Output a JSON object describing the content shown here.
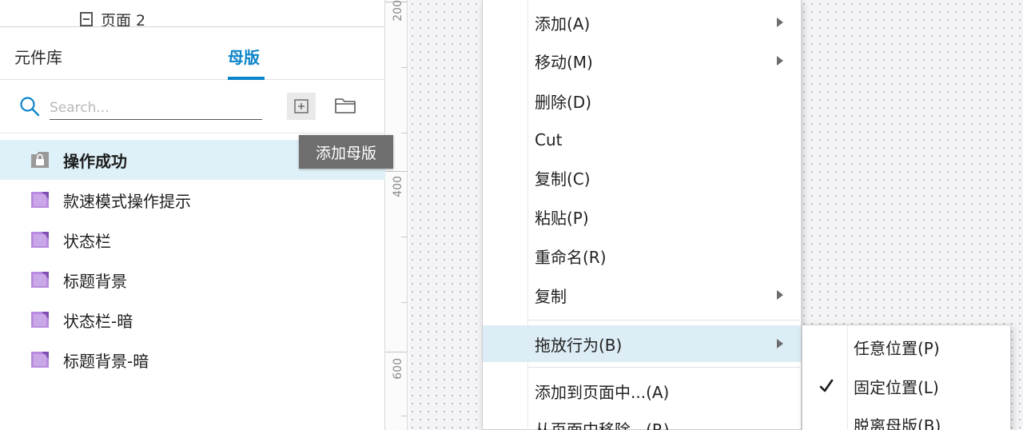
{
  "pages": {
    "partial_page_label": "页面 2"
  },
  "panel": {
    "tabs": [
      {
        "label": "元件库",
        "active": false
      },
      {
        "label": "母版",
        "active": true
      }
    ],
    "search": {
      "placeholder": "Search...",
      "value": ""
    },
    "tooltip": "添加母版",
    "masters": [
      {
        "label": "操作成功",
        "selected": true,
        "icon": "locked-master-icon"
      },
      {
        "label": "款速模式操作提示",
        "selected": false,
        "icon": "master-icon"
      },
      {
        "label": "状态栏",
        "selected": false,
        "icon": "master-icon"
      },
      {
        "label": "标题背景",
        "selected": false,
        "icon": "master-icon"
      },
      {
        "label": "状态栏-暗",
        "selected": false,
        "icon": "master-icon"
      },
      {
        "label": "标题背景-暗",
        "selected": false,
        "icon": "master-icon"
      }
    ]
  },
  "ruler": {
    "labels": [
      "200",
      "400",
      "600"
    ]
  },
  "context_menu": {
    "items": [
      {
        "label": "添加(A)",
        "has_submenu": true
      },
      {
        "label": "移动(M)",
        "has_submenu": true
      },
      {
        "label": "删除(D)",
        "has_submenu": false
      },
      {
        "label": "Cut",
        "has_submenu": false
      },
      {
        "label": "复制(C)",
        "has_submenu": false
      },
      {
        "label": "粘贴(P)",
        "has_submenu": false
      },
      {
        "label": "重命名(R)",
        "has_submenu": false
      },
      {
        "label": "复制",
        "has_submenu": true
      },
      {
        "label": "拖放行为(B)",
        "has_submenu": true,
        "highlighted": true
      },
      {
        "label": "添加到页面中...(A)",
        "has_submenu": false
      },
      {
        "label": "从页面中移除...(R)",
        "has_submenu": false
      }
    ],
    "submenu": {
      "items": [
        {
          "label": "任意位置(P)",
          "checked": false
        },
        {
          "label": "固定位置(L)",
          "checked": true
        },
        {
          "label": "脱离母版(B)",
          "checked": false
        }
      ]
    }
  },
  "colors": {
    "accent": "#0d85c9",
    "selected_row_bg": "#dff1f8",
    "menu_hover_bg": "#dcedf5",
    "master_icon": "#b98be0",
    "locked_master_icon": "#8e8e8e",
    "tooltip_bg": "#6e6e6e"
  }
}
